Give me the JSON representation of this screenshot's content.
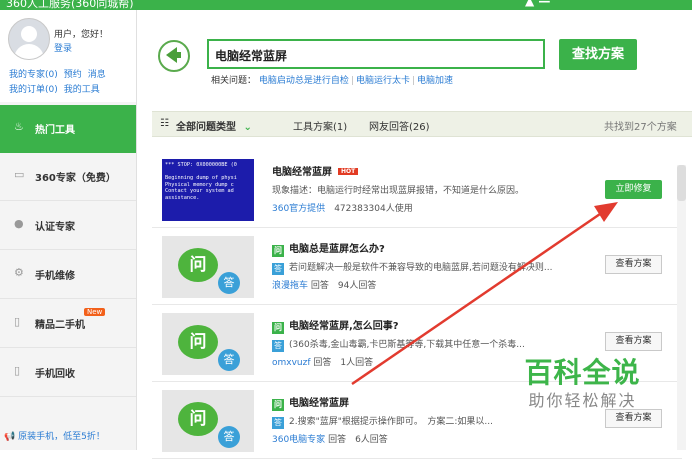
{
  "window": {
    "title": "360人工服务(360同城帮)"
  },
  "colors": {
    "brand_green": "#3bb24a",
    "link_blue": "#2b7cd3",
    "arrow_red": "#e23b2f"
  },
  "user": {
    "greeting": "用户，您好！",
    "login": "登录",
    "links_row1": [
      "我的专家(0)",
      "预约",
      "消息"
    ],
    "links_row2": [
      "我的订单(0)",
      "我的工具"
    ]
  },
  "sidebar": {
    "items": [
      {
        "label": "热门工具",
        "icon": "flame-icon",
        "active": true
      },
      {
        "label": "360专家（免费）",
        "icon": "monitor-icon"
      },
      {
        "label": "认证专家",
        "icon": "person-icon"
      },
      {
        "label": "手机维修",
        "icon": "gear-icon"
      },
      {
        "label": "精品二手机",
        "icon": "phone-icon",
        "badge": "New"
      },
      {
        "label": "手机回收",
        "icon": "recycle-phone-icon"
      }
    ],
    "promo": "原装手机，低至5折！"
  },
  "search": {
    "query": "电脑经常蓝屏",
    "button": "查找方案",
    "related_label": "相关问题：",
    "related": [
      "电脑启动总是进行自检",
      "电脑运行太卡",
      "电脑加速"
    ]
  },
  "filters": {
    "all_types": "全部问题类型",
    "tool": "工具方案(1)",
    "community": "网友回答(26)",
    "total": "共找到27个方案"
  },
  "results": [
    {
      "title": "电脑经常蓝屏",
      "hot": "HOT",
      "desc": "现象描述：电脑运行时经常出现蓝屏报错，不知道是什么原因。",
      "source": "360官方提供",
      "meta": "472383304人使用",
      "button": "立即修复",
      "thumb_text": "*** STOP: 0X000000BE (0\n\nBeginning dump of physi\nPhysical memory dump c\nContact your system ad\nassistance."
    },
    {
      "title": "电脑总是蓝屏怎么办?",
      "answer": "若问题解决一般是软件不兼容导致的电脑蓝屏,若问题没有解决则...",
      "source": "浪漫拖车",
      "meta": "回答　94人回答",
      "button": "查看方案"
    },
    {
      "title": "电脑经常蓝屏,怎么回事?",
      "answer": "(360杀毒,金山毒霸,卡巴斯基等等,下载其中任意一个杀毒...",
      "source": "omxvuzf",
      "meta": "回答　1人回答",
      "button": "查看方案"
    },
    {
      "title": "电脑经常蓝屏",
      "answer": "2.搜索\"蓝屏\"根据提示操作即可。　方案二:如果以...",
      "source": "360电脑专家",
      "meta": "回答　6人回答",
      "button": "查看方案"
    }
  ],
  "watermark": {
    "line1": "百科全说",
    "line2": "助你轻松解决"
  }
}
